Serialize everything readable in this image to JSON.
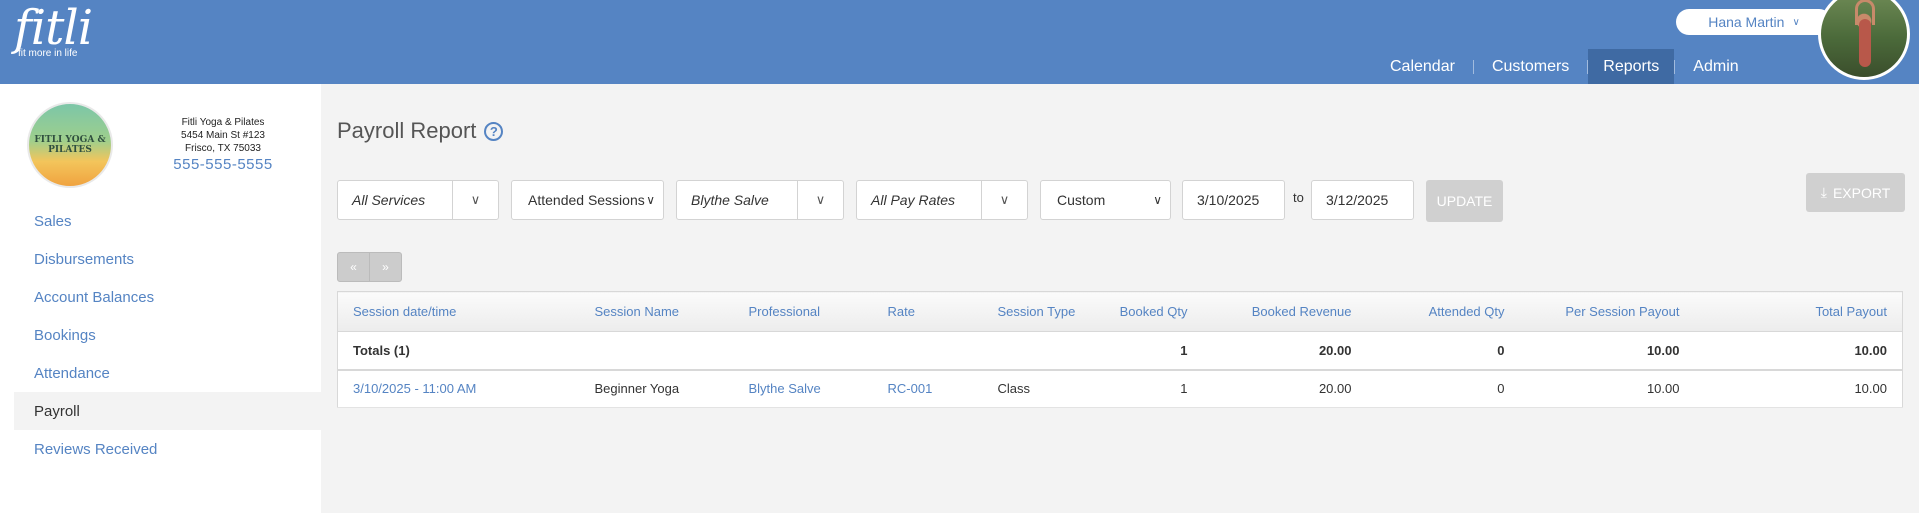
{
  "brand": {
    "logo": "fitli",
    "tagline": "fit more in life"
  },
  "user": {
    "name": "Hana Martin"
  },
  "nav": [
    "Calendar",
    "Customers",
    "Reports",
    "Admin"
  ],
  "business": {
    "logo_text": "FITLI YOGA & PILATES",
    "name": "Fitli Yoga & Pilates",
    "street": "5454 Main St #123",
    "city": "Frisco, TX 75033",
    "phone": "555-555-5555"
  },
  "sidebar": [
    "Sales",
    "Disbursements",
    "Account Balances",
    "Bookings",
    "Attendance",
    "Payroll",
    "Reviews Received"
  ],
  "page": {
    "title": "Payroll Report",
    "help": "?"
  },
  "filters": {
    "services": "All Services",
    "sessions": "Attended Sessions",
    "professional": "Blythe Salve",
    "pay_rates": "All Pay Rates",
    "range": "Custom",
    "from": "3/10/2025",
    "to_label": "to",
    "to": "3/12/2025",
    "update": "UPDATE",
    "export": "EXPORT"
  },
  "pager": {
    "prev": "«",
    "next": "»"
  },
  "table": {
    "headers": [
      "Session date/time",
      "Session Name",
      "Professional",
      "Rate",
      "Session Type",
      "Booked Qty",
      "Booked Revenue",
      "Attended Qty",
      "Per Session Payout",
      "Total Payout"
    ],
    "totals": [
      "Totals (1)",
      "",
      "",
      "",
      "",
      "1",
      "20.00",
      "0",
      "10.00",
      "10.00"
    ],
    "rows": [
      [
        "3/10/2025 - 11:00 AM",
        "Beginner Yoga",
        "Blythe Salve",
        "RC-001",
        "Class",
        "1",
        "20.00",
        "0",
        "10.00",
        "10.00"
      ]
    ]
  },
  "colors": {
    "header": "#5584c3",
    "nav_active": "#3f6aa3",
    "link": "#5584c3"
  }
}
